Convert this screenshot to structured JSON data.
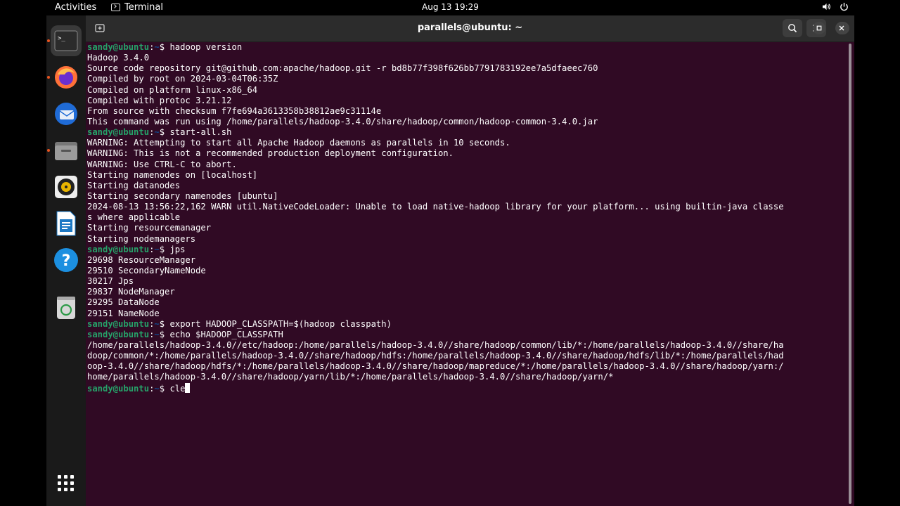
{
  "topbar": {
    "activities": "Activities",
    "app_name": "Terminal",
    "clock": "Aug 13  19:29"
  },
  "window": {
    "title": "parallels@ubuntu: ~"
  },
  "dock": {
    "items": [
      {
        "name": "terminal-icon"
      },
      {
        "name": "firefox-icon"
      },
      {
        "name": "thunderbird-icon"
      },
      {
        "name": "files-icon"
      },
      {
        "name": "rhythmbox-icon"
      },
      {
        "name": "writer-icon"
      },
      {
        "name": "help-icon"
      },
      {
        "name": "trash-icon"
      },
      {
        "name": "show-apps-icon"
      }
    ]
  },
  "prompt": {
    "user": "sandy@ubuntu",
    "path": "~",
    "symbol": "$"
  },
  "terminal": {
    "lines": [
      {
        "type": "prompt",
        "cmd": "hadoop version"
      },
      {
        "type": "out",
        "text": "Hadoop 3.4.0"
      },
      {
        "type": "out",
        "text": "Source code repository git@github.com:apache/hadoop.git -r bd8b77f398f626bb7791783192ee7a5dfaeec760"
      },
      {
        "type": "out",
        "text": "Compiled by root on 2024-03-04T06:35Z"
      },
      {
        "type": "out",
        "text": "Compiled on platform linux-x86_64"
      },
      {
        "type": "out",
        "text": "Compiled with protoc 3.21.12"
      },
      {
        "type": "out",
        "text": "From source with checksum f7fe694a3613358b38812ae9c31114e"
      },
      {
        "type": "out",
        "text": "This command was run using /home/parallels/hadoop-3.4.0/share/hadoop/common/hadoop-common-3.4.0.jar"
      },
      {
        "type": "prompt",
        "cmd": "start-all.sh"
      },
      {
        "type": "out",
        "text": "WARNING: Attempting to start all Apache Hadoop daemons as parallels in 10 seconds."
      },
      {
        "type": "out",
        "text": "WARNING: This is not a recommended production deployment configuration."
      },
      {
        "type": "out",
        "text": "WARNING: Use CTRL-C to abort."
      },
      {
        "type": "out",
        "text": "Starting namenodes on [localhost]"
      },
      {
        "type": "out",
        "text": "Starting datanodes"
      },
      {
        "type": "out",
        "text": "Starting secondary namenodes [ubuntu]"
      },
      {
        "type": "out",
        "text": "2024-08-13 13:56:22,162 WARN util.NativeCodeLoader: Unable to load native-hadoop library for your platform... using builtin-java classe"
      },
      {
        "type": "out",
        "text": "s where applicable"
      },
      {
        "type": "out",
        "text": "Starting resourcemanager"
      },
      {
        "type": "out",
        "text": "Starting nodemanagers"
      },
      {
        "type": "prompt",
        "cmd": "jps"
      },
      {
        "type": "out",
        "text": "29698 ResourceManager"
      },
      {
        "type": "out",
        "text": "29510 SecondaryNameNode"
      },
      {
        "type": "out",
        "text": "30217 Jps"
      },
      {
        "type": "out",
        "text": "29837 NodeManager"
      },
      {
        "type": "out",
        "text": "29295 DataNode"
      },
      {
        "type": "out",
        "text": "29151 NameNode"
      },
      {
        "type": "prompt",
        "cmd": "export HADOOP_CLASSPATH=$(hadoop classpath)"
      },
      {
        "type": "prompt",
        "cmd": "echo $HADOOP_CLASSPATH"
      },
      {
        "type": "out",
        "text": "/home/parallels/hadoop-3.4.0//etc/hadoop:/home/parallels/hadoop-3.4.0//share/hadoop/common/lib/*:/home/parallels/hadoop-3.4.0//share/ha"
      },
      {
        "type": "out",
        "text": "doop/common/*:/home/parallels/hadoop-3.4.0//share/hadoop/hdfs:/home/parallels/hadoop-3.4.0//share/hadoop/hdfs/lib/*:/home/parallels/had"
      },
      {
        "type": "out",
        "text": "oop-3.4.0//share/hadoop/hdfs/*:/home/parallels/hadoop-3.4.0//share/hadoop/mapreduce/*:/home/parallels/hadoop-3.4.0//share/hadoop/yarn:/"
      },
      {
        "type": "out",
        "text": "home/parallels/hadoop-3.4.0//share/hadoop/yarn/lib/*:/home/parallels/hadoop-3.4.0//share/hadoop/yarn/*"
      },
      {
        "type": "prompt",
        "cmd": "cle",
        "cursor": true
      }
    ]
  },
  "colors": {
    "terminal_bg": "#300a24",
    "prompt_user": "#26a269",
    "prompt_path": "#12488b",
    "accent": "#e95420"
  }
}
